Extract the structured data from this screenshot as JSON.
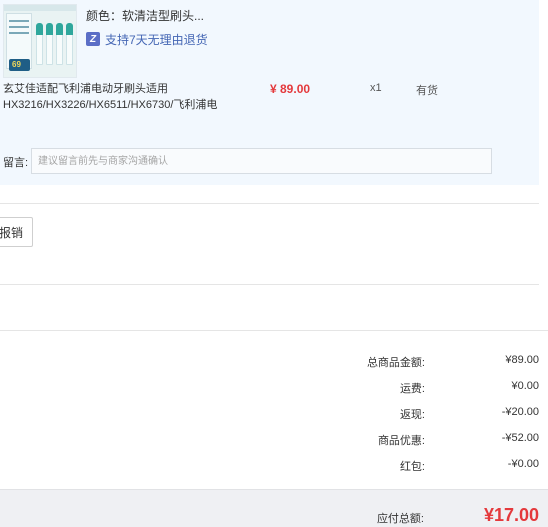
{
  "item": {
    "color_label": "颜色：",
    "color_value": "软清洁型刷头...",
    "return_badge": "Z",
    "return_policy": "支持7天无理由退货",
    "name": "玄艾佳适配飞利浦电动牙刷头适用HX3216/HX3226/HX6511/HX6730/飞利浦电",
    "price": "¥ 89.00",
    "quantity": "x1",
    "stock": "有货",
    "thumb_price": "69"
  },
  "note": {
    "label": "留言:",
    "placeholder": "建议留言前先与商家沟通确认"
  },
  "invoice": {
    "button_label": "报销"
  },
  "summary": {
    "rows": [
      {
        "label": "总商品金额:",
        "value": "¥89.00"
      },
      {
        "label": "运费:",
        "value": "¥0.00"
      },
      {
        "label": "返现:",
        "value": "-¥20.00"
      },
      {
        "label": "商品优惠:",
        "value": "-¥52.00"
      },
      {
        "label": "红包:",
        "value": "-¥0.00"
      }
    ],
    "total_label": "应付总额:",
    "total_value": "¥17.00"
  },
  "colors": {
    "panel_bg": "#f2f8fe",
    "price_red": "#e4393c",
    "return_blue": "#4466b4",
    "total_bar_bg": "#eff0f3"
  }
}
